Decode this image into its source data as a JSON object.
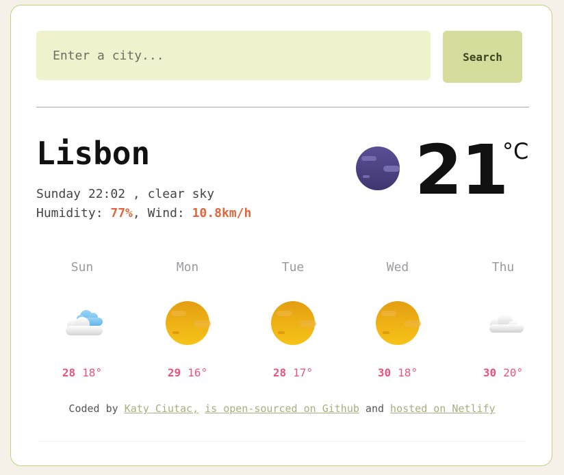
{
  "search": {
    "placeholder": "Enter a city...",
    "button_label": "Search"
  },
  "current": {
    "city": "Lisbon",
    "day_time": "Sunday 22:02",
    "separator": " , ",
    "description": "clear sky",
    "humidity_label": "Humidity: ",
    "humidity_value": "77%",
    "wind_label": ", Wind: ",
    "wind_value": "10.8km/h",
    "temperature": "21",
    "unit": "°C",
    "icon": "night-clear-moon-icon"
  },
  "forecast": [
    {
      "day": "Sun",
      "max": "28",
      "min": "18°",
      "icon": "partly-cloudy-icon"
    },
    {
      "day": "Mon",
      "max": "29",
      "min": "16°",
      "icon": "sun-icon"
    },
    {
      "day": "Tue",
      "max": "28",
      "min": "17°",
      "icon": "sun-icon"
    },
    {
      "day": "Wed",
      "max": "30",
      "min": "18°",
      "icon": "sun-icon"
    },
    {
      "day": "Thu",
      "max": "30",
      "min": "20°",
      "icon": "cloud-icon"
    }
  ],
  "footer": {
    "prefix": "Coded by ",
    "author_link": "Katy Ciutac,",
    "github_link": "is open-sourced on Github",
    "middle": " and ",
    "netlify_link": "hosted on Netlify"
  },
  "colors": {
    "accent_orange": "#e2663c",
    "accent_pink": "#e8557c",
    "input_bg": "#eff3cd",
    "button_bg": "#d6dc9b",
    "card_border": "#c8d17a"
  }
}
